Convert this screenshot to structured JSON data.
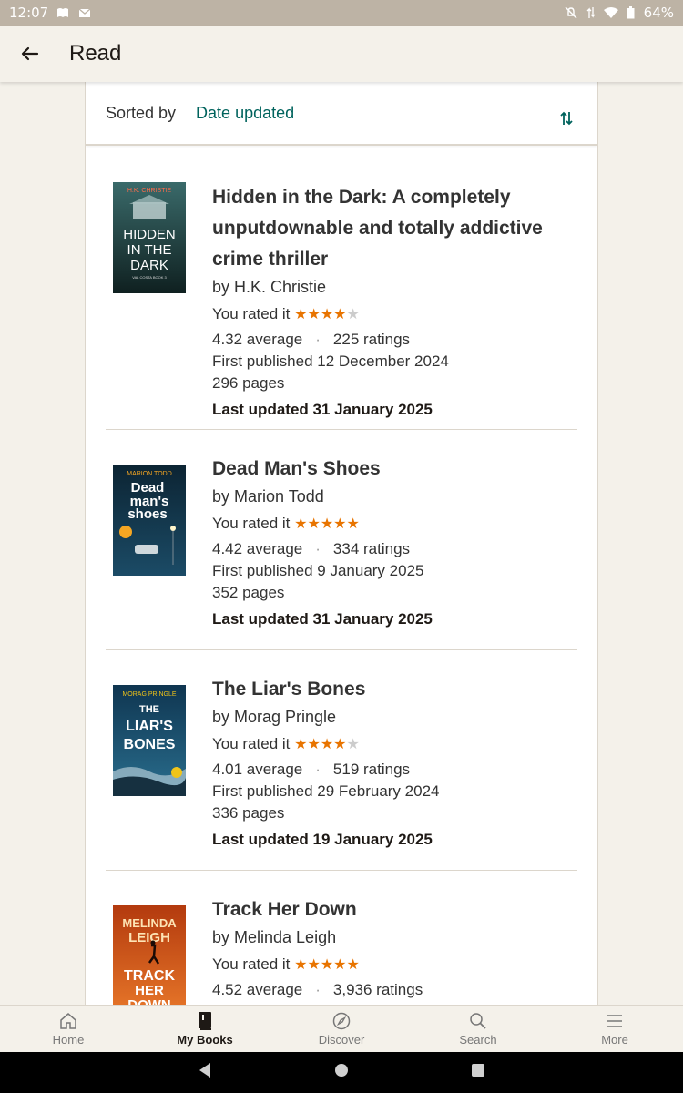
{
  "status_bar": {
    "time": "12:07",
    "battery": "64%"
  },
  "app_bar": {
    "title": "Read",
    "back_icon": "arrow-left-icon"
  },
  "sort": {
    "label": "Sorted by",
    "value": "Date updated",
    "toggle_icon": "sort-toggle-icon"
  },
  "books": [
    {
      "title": "Hidden in the Dark: A completely unputdownable and totally addictive crime thriller",
      "author": "by H.K. Christie",
      "rated_label": "You rated it",
      "user_rating": 4,
      "average": "4.32 average",
      "ratings": "225 ratings",
      "first_published": "First published 12 December 2024",
      "pages": "296 pages",
      "last_updated": "Last updated 31 January 2025",
      "cover": {
        "author": "H.K. CHRISTIE",
        "title_lines": [
          "HIDDEN",
          "IN THE",
          "DARK"
        ],
        "sub": "VAL COSTA BOOK 3",
        "bg": "#1f3b3c",
        "accent": "#e0432b"
      }
    },
    {
      "title": "Dead Man's Shoes",
      "author": "by Marion Todd",
      "rated_label": "You rated it",
      "user_rating": 5,
      "average": "4.42 average",
      "ratings": "334 ratings",
      "first_published": "First published 9 January 2025",
      "pages": "352 pages",
      "last_updated": "Last updated 31 January 2025",
      "cover": {
        "author": "MARION TODD",
        "title_lines": [
          "Dead",
          "man's",
          "shoes"
        ],
        "bg": "#0d2a3a",
        "accent": "#f5a623"
      }
    },
    {
      "title": "The Liar's Bones",
      "author": "by Morag Pringle",
      "rated_label": "You rated it",
      "user_rating": 4,
      "average": "4.01 average",
      "ratings": "519 ratings",
      "first_published": "First published 29 February 2024",
      "pages": "336 pages",
      "last_updated": "Last updated 19 January 2025",
      "cover": {
        "author": "MORAG PRINGLE",
        "title_lines": [
          "THE",
          "LIAR'S",
          "BONES"
        ],
        "bg": "#163a52",
        "accent": "#f0c419"
      }
    },
    {
      "title": "Track Her Down",
      "author": "by Melinda Leigh",
      "rated_label": "You rated it",
      "user_rating": 5,
      "average": "4.52 average",
      "ratings": "3,936 ratings",
      "cover": {
        "author": "MELINDA",
        "author2": "LEIGH",
        "title_lines": [
          "TRACK",
          "HER",
          "DOWN"
        ],
        "bg": "#c64a14",
        "accent": "#fde4b5"
      }
    }
  ],
  "bottom_nav": [
    {
      "label": "Home",
      "icon": "home-icon",
      "active": false
    },
    {
      "label": "My Books",
      "icon": "book-icon",
      "active": true
    },
    {
      "label": "Discover",
      "icon": "compass-icon",
      "active": false
    },
    {
      "label": "Search",
      "icon": "search-icon",
      "active": false
    },
    {
      "label": "More",
      "icon": "menu-icon",
      "active": false
    }
  ],
  "colors": {
    "accent": "#00635d",
    "star": "#e87400",
    "background": "#f4f1ea"
  }
}
